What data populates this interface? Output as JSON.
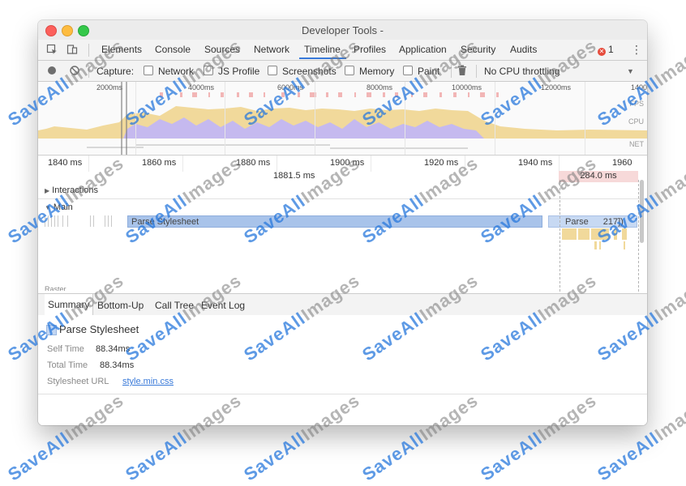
{
  "window": {
    "title": "Developer Tools -"
  },
  "tabs": [
    {
      "label": "Elements",
      "active": false
    },
    {
      "label": "Console",
      "active": false
    },
    {
      "label": "Sources",
      "active": false
    },
    {
      "label": "Network",
      "active": false
    },
    {
      "label": "Timeline",
      "active": true
    },
    {
      "label": "Profiles",
      "active": false
    },
    {
      "label": "Application",
      "active": false
    },
    {
      "label": "Security",
      "active": false
    },
    {
      "label": "Audits",
      "active": false
    }
  ],
  "error_count": "1",
  "toolbar": {
    "capture_label": "Capture:",
    "checkboxes": [
      {
        "label": "Network",
        "checked": false
      },
      {
        "label": "JS Profile",
        "checked": false
      },
      {
        "label": "Screenshots",
        "checked": false
      },
      {
        "label": "Memory",
        "checked": false
      },
      {
        "label": "Paint",
        "checked": false
      }
    ],
    "throttle_label": "No CPU throttling"
  },
  "overview": {
    "ticks": [
      "2000ms",
      "4000ms",
      "6000ms",
      "8000ms",
      "10000ms",
      "12000ms",
      "1400"
    ],
    "lanes": [
      "FPS",
      "CPU",
      "NET"
    ]
  },
  "ruler": {
    "ticks": [
      "1840 ms",
      "1860 ms",
      "1880 ms",
      "1900 ms",
      "1920 ms",
      "1940 ms",
      "1960"
    ],
    "cursor_time": "1881.5 ms",
    "duration": "284.0 ms"
  },
  "sections": {
    "interactions": "Interactions",
    "main": "Main",
    "raster": "Raster"
  },
  "bars": {
    "main_task": "Parse Stylesheet",
    "next_task": "Parse",
    "next_task_suffix": "217])"
  },
  "details_tabs": [
    {
      "label": "Summary",
      "active": true
    },
    {
      "label": "Bottom-Up",
      "active": false
    },
    {
      "label": "Call Tree",
      "active": false
    },
    {
      "label": "Event Log",
      "active": false
    }
  ],
  "details": {
    "title": "Parse Stylesheet",
    "self_time_label": "Self Time",
    "self_time_value": "88.34ms",
    "total_time_label": "Total Time",
    "total_time_value": "88.34ms",
    "stylesheet_label": "Stylesheet URL",
    "stylesheet_value": "style.min.css"
  },
  "watermark": {
    "brand": "SaveAll",
    "suffix": "Images"
  },
  "colors": {
    "accent": "#3879d9",
    "css_bar": "#a8c3ea",
    "cpu_scripting": "#f1d99b",
    "cpu_rendering": "#c5b9ef",
    "fps_red": "#f2b6b6",
    "close": "#fc605c",
    "minimize": "#fdbc40",
    "zoom": "#34c84a"
  }
}
